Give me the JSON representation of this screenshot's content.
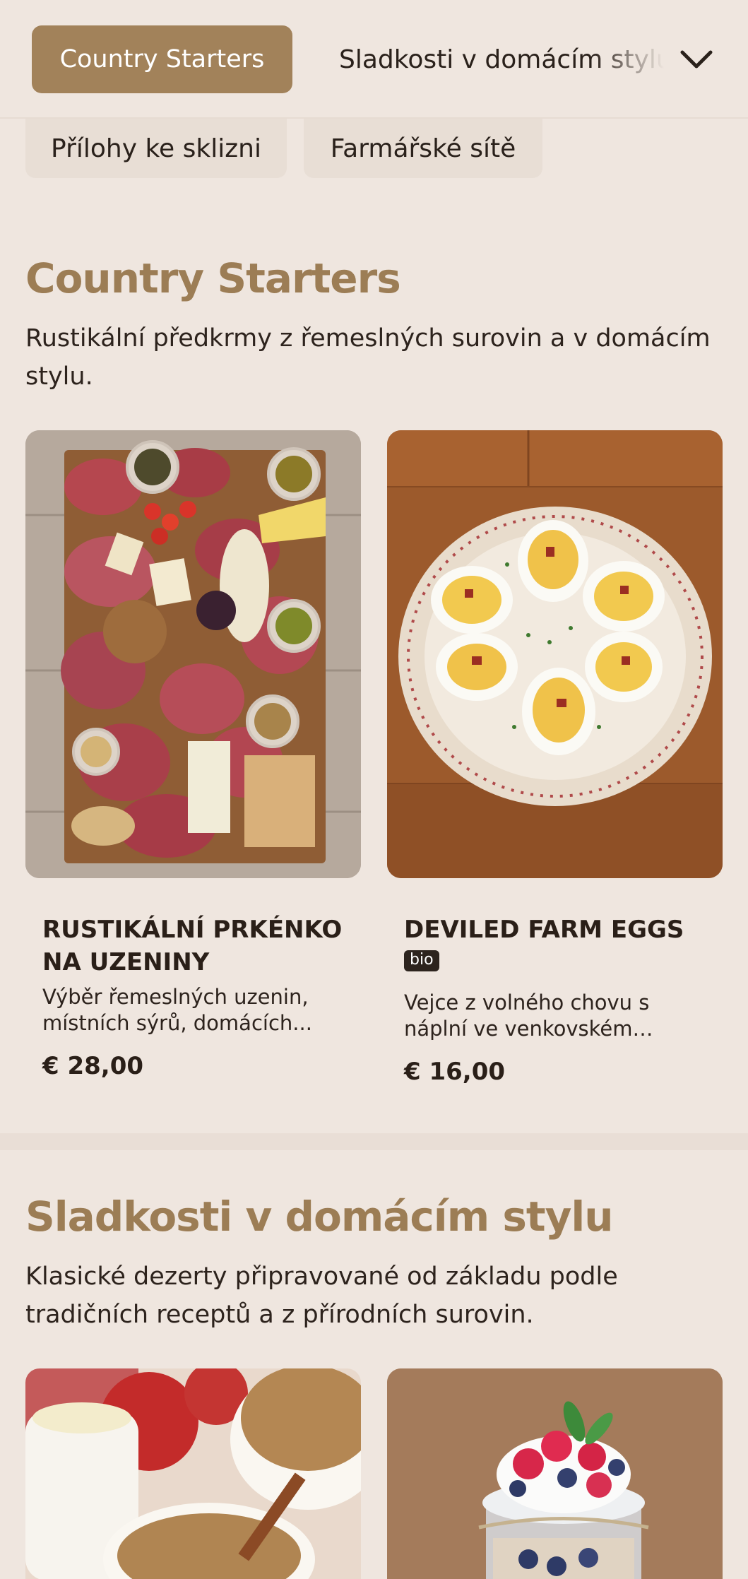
{
  "header": {
    "active_tab": "Country Starters",
    "next_tab": "Sladkosti v domácím stylu",
    "more_icon": "chevron-down-icon"
  },
  "chips": [
    {
      "label": "Přílohy ke sklizni"
    },
    {
      "label": "Farmářské sítě"
    }
  ],
  "sections": [
    {
      "title": "Country Starters",
      "description": "Rustikální předkrmy z řemeslných surovin a v domácím stylu.",
      "items": [
        {
          "name": "Rustikální prkénko na uzeniny",
          "description": "Výběr řemeslných uzenin, místních sýrů, domácích...",
          "price": "€ 28,00",
          "image": "charcuterie-board-photo"
        },
        {
          "name": "Deviled Farm Eggs",
          "badge": "bio",
          "description": "Vejce z volného chovu s náplní ve venkovském stylu,...",
          "price": "€ 16,00",
          "image": "deviled-eggs-photo"
        }
      ]
    },
    {
      "title": "Sladkosti v domácím stylu",
      "description": "Klasické dezerty připravované od základu podle tradičních receptů a z přírodních surovin.",
      "items": [
        {
          "image": "apple-crumble-photo"
        },
        {
          "image": "berry-parfait-jar-photo"
        }
      ]
    }
  ],
  "colors": {
    "background": "#efe6df",
    "accent": "#a2825a",
    "title": "#9c7d55"
  }
}
